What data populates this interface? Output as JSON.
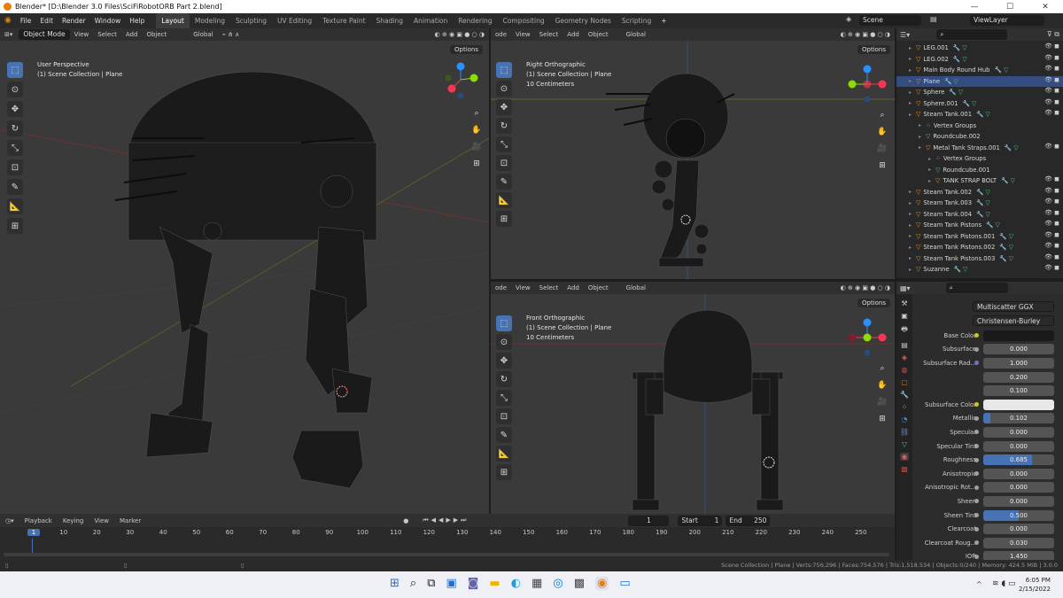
{
  "window": {
    "title": "Blender* [D:\\Blender 3.0 Files\\SciFiRobotORB Part 2.blend]",
    "minimize": "—",
    "maximize": "☐",
    "close": "✕"
  },
  "menu": [
    "File",
    "Edit",
    "Render",
    "Window",
    "Help"
  ],
  "workspaces": [
    "Layout",
    "Modeling",
    "Sculpting",
    "UV Editing",
    "Texture Paint",
    "Shading",
    "Animation",
    "Rendering",
    "Compositing",
    "Geometry Nodes",
    "Scripting"
  ],
  "active_workspace": "Layout",
  "scene": "Scene",
  "view_layer": "ViewLayer",
  "viewport_main": {
    "mode": "Object Mode",
    "menu": [
      "View",
      "Select",
      "Add",
      "Object"
    ],
    "transform": "Global",
    "options": "Options",
    "info_title": "User Perspective",
    "info_collection": "(1) Scene Collection | Plane"
  },
  "viewport_right": {
    "mode": "ode",
    "menu": [
      "View",
      "Select",
      "Add",
      "Object"
    ],
    "transform": "Global",
    "options": "Options",
    "info_title": "Right Orthographic",
    "info_collection": "(1) Scene Collection | Plane",
    "info_scale": "10 Centimeters"
  },
  "viewport_front": {
    "mode": "ode",
    "menu": [
      "View",
      "Select",
      "Add",
      "Object"
    ],
    "transform": "Global",
    "options": "Options",
    "info_title": "Front Orthographic",
    "info_collection": "(1) Scene Collection | Plane",
    "info_scale": "10 Centimeters"
  },
  "outliner": {
    "rows": [
      {
        "name": "LEG.001",
        "depth": 0,
        "icon": "object"
      },
      {
        "name": "LEG.002",
        "depth": 0,
        "icon": "object"
      },
      {
        "name": "Main Body Round Hub",
        "depth": 0,
        "icon": "object"
      },
      {
        "name": "Plane",
        "depth": 0,
        "icon": "object",
        "selected": true
      },
      {
        "name": "Sphere",
        "depth": 0,
        "icon": "object"
      },
      {
        "name": "Sphere.001",
        "depth": 0,
        "icon": "object"
      },
      {
        "name": "Steam Tank.001",
        "depth": 0,
        "icon": "object"
      },
      {
        "name": "Vertex Groups",
        "depth": 1,
        "icon": "group"
      },
      {
        "name": "Roundcube.002",
        "depth": 1,
        "icon": "mesh"
      },
      {
        "name": "Metal Tank Straps.001",
        "depth": 1,
        "icon": "object"
      },
      {
        "name": "Vertex Groups",
        "depth": 2,
        "icon": "group"
      },
      {
        "name": "Roundcube.001",
        "depth": 2,
        "icon": "mesh"
      },
      {
        "name": "TANK STRAP BOLT",
        "depth": 2,
        "icon": "object"
      },
      {
        "name": "Steam Tank.002",
        "depth": 0,
        "icon": "object"
      },
      {
        "name": "Steam Tank.003",
        "depth": 0,
        "icon": "object"
      },
      {
        "name": "Steam Tank.004",
        "depth": 0,
        "icon": "object"
      },
      {
        "name": "Steam Tank Pistons",
        "depth": 0,
        "icon": "object"
      },
      {
        "name": "Steam Tank Pistons.001",
        "depth": 0,
        "icon": "object"
      },
      {
        "name": "Steam Tank Pistons.002",
        "depth": 0,
        "icon": "object"
      },
      {
        "name": "Steam Tank Pistons.003",
        "depth": 0,
        "icon": "object"
      },
      {
        "name": "Suzanne",
        "depth": 0,
        "icon": "object"
      }
    ]
  },
  "properties": {
    "distribution": "Multiscatter GGX",
    "subsurface_method": "Christensen-Burley",
    "rows": [
      {
        "label": "Base Color",
        "value": "",
        "kind": "color",
        "swatch": "#1a1a1a",
        "dot": "yellow"
      },
      {
        "label": "Subsurface",
        "value": "0.000",
        "kind": "num",
        "fill": 0,
        "dot": "gray"
      },
      {
        "label": "Subsurface Rad...",
        "value": "1.000",
        "kind": "num",
        "fill": 0,
        "dot": "blue"
      },
      {
        "label": "",
        "value": "0.200",
        "kind": "num",
        "fill": 0,
        "dot": "none"
      },
      {
        "label": "",
        "value": "0.100",
        "kind": "num",
        "fill": 0,
        "dot": "none"
      },
      {
        "label": "Subsurface Color",
        "value": "",
        "kind": "color",
        "swatch": "#e8e8e8",
        "dot": "yellow"
      },
      {
        "label": "Metallic",
        "value": "0.102",
        "kind": "num",
        "fill": 0.102,
        "dot": "gray"
      },
      {
        "label": "Specular",
        "value": "0.000",
        "kind": "num",
        "fill": 0,
        "dot": "gray"
      },
      {
        "label": "Specular Tint",
        "value": "0.000",
        "kind": "num",
        "fill": 0,
        "dot": "gray"
      },
      {
        "label": "Roughness",
        "value": "0.685",
        "kind": "num",
        "fill": 0.685,
        "dot": "gray"
      },
      {
        "label": "Anisotropic",
        "value": "0.000",
        "kind": "num",
        "fill": 0,
        "dot": "gray"
      },
      {
        "label": "Anisotropic Rot...",
        "value": "0.000",
        "kind": "num",
        "fill": 0,
        "dot": "gray"
      },
      {
        "label": "Sheen",
        "value": "0.000",
        "kind": "num",
        "fill": 0,
        "dot": "gray"
      },
      {
        "label": "Sheen Tint",
        "value": "0.500",
        "kind": "num",
        "fill": 0.5,
        "dot": "gray"
      },
      {
        "label": "Clearcoat",
        "value": "0.000",
        "kind": "num",
        "fill": 0,
        "dot": "gray"
      },
      {
        "label": "Clearcoat Roug...",
        "value": "0.030",
        "kind": "num",
        "fill": 0,
        "dot": "gray"
      },
      {
        "label": "IOR",
        "value": "1.450",
        "kind": "num",
        "fill": 0,
        "dot": "gray"
      }
    ]
  },
  "timeline": {
    "menu": [
      "Playback",
      "Keying",
      "View",
      "Marker"
    ],
    "current_frame": "1",
    "start_label": "Start",
    "start": "1",
    "end_label": "End",
    "end": "250",
    "ticks": [
      "1",
      "10",
      "20",
      "30",
      "40",
      "50",
      "60",
      "70",
      "80",
      "90",
      "100",
      "110",
      "120",
      "130",
      "140",
      "150",
      "160",
      "170",
      "180",
      "190",
      "200",
      "210",
      "220",
      "230",
      "240",
      "250"
    ]
  },
  "statusbar": "Scene Collection | Plane | Verts:756,296 | Faces:754,576 | Tris:1,518,534 | Objects:0/240 | Memory: 424.5 MiB | 3.0.0",
  "taskbar": {
    "time": "6:05 PM",
    "date": "2/15/2022",
    "chevron": "^"
  },
  "colors": {
    "accent": "#4772b3",
    "x_axis": "#ff3352",
    "y_axis": "#8bdc00",
    "z_axis": "#2890ff",
    "orange": "#e87d0d"
  }
}
